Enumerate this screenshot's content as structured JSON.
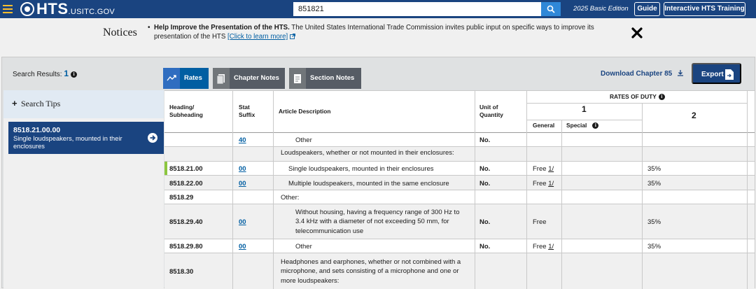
{
  "header": {
    "logo_main": "HTS",
    "logo_sub": ".USITC.GOV",
    "search_value": "851821",
    "edition": "2025 Basic Edition",
    "guide_label": "Guide",
    "training_label": "Interactive HTS Training"
  },
  "notices": {
    "title": "Notices",
    "headline": "Help Improve the Presentation of the HTS.",
    "body": " The United States International Trade Commission invites public input on specific ways to improve its presentation of the HTS ",
    "link": "[Click to learn more]"
  },
  "results": {
    "label": "Search Results: ",
    "count": "1",
    "info": "i"
  },
  "tabs": {
    "rates": "Rates",
    "chapter_notes": "Chapter Notes",
    "section_notes": "Section Notes"
  },
  "toolbar": {
    "download": "Download Chapter 85",
    "export": "Export"
  },
  "sidebar": {
    "search_tips": "Search Tips",
    "result_code": "8518.21.00.00",
    "result_desc": "Single loudspeakers, mounted in their enclosures"
  },
  "table": {
    "headers": {
      "heading_line1": "Heading/",
      "heading_line2": "Subheading",
      "stat_line1": "Stat",
      "stat_line2": "Suffix",
      "article": "Article Description",
      "unit_line1": "Unit of",
      "unit_line2": "Quantity",
      "rates_of_duty": "RATES OF DUTY",
      "col1": "1",
      "col2": "2",
      "general": "General",
      "special": "Special"
    },
    "rows": [
      {
        "heading": "",
        "stat": "40",
        "desc": "Other",
        "unit": "No.",
        "general": "",
        "special": "",
        "col2": ""
      },
      {
        "heading": "",
        "stat": "",
        "desc": "Loudspeakers, whether or not mounted in their enclosures:",
        "unit": "",
        "general": "",
        "special": "",
        "col2": ""
      },
      {
        "heading": "8518.21.00",
        "stat": "00",
        "desc": "Single loudspeakers, mounted in their enclosures",
        "unit": "No.",
        "general": "Free ",
        "general_fn": "1/",
        "special": "",
        "col2": "35%"
      },
      {
        "heading": "8518.22.00",
        "stat": "00",
        "desc": "Multiple loudspeakers, mounted in the same enclosure",
        "unit": "No.",
        "general": "Free ",
        "general_fn": "1/",
        "special": "",
        "col2": "35%"
      },
      {
        "heading": "8518.29",
        "stat": "",
        "desc": "Other:",
        "unit": "",
        "general": "",
        "special": "",
        "col2": ""
      },
      {
        "heading": "8518.29.40",
        "stat": "00",
        "desc": "Without housing, having a frequency range of 300 Hz to 3.4 kHz with a diameter of not exceeding 50 mm, for telecommunication use",
        "unit": "No.",
        "general": "Free",
        "special": "",
        "col2": "35%"
      },
      {
        "heading": "8518.29.80",
        "stat": "00",
        "desc": "Other",
        "unit": "No.",
        "general": "Free ",
        "general_fn": "1/",
        "special": "",
        "col2": "35%"
      },
      {
        "heading": "8518.30",
        "stat": "",
        "desc": "Headphones and earphones, whether or not combined with a microphone, and sets consisting of a microphone and one or more loudspeakers:",
        "unit": "",
        "general": "",
        "special": "",
        "col2": ""
      }
    ]
  },
  "colors": {
    "navy": "#1a4480",
    "link": "#005ea2",
    "highlight": "#8cc63f"
  }
}
